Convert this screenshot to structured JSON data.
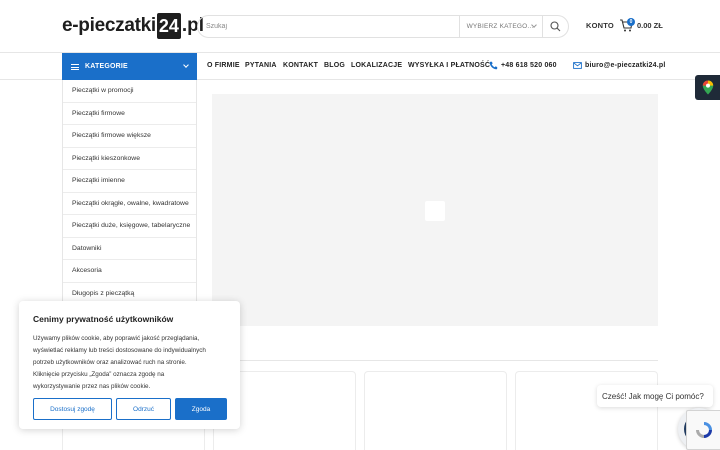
{
  "header": {
    "logo": {
      "prefix": "e-pieczatki",
      "number": "24",
      "suffix": ".pl"
    },
    "search": {
      "placeholder": "Szukaj",
      "category_select": "WYBIERZ KATEGO..."
    },
    "account_label": "KONTO",
    "cart": {
      "count": "0",
      "total": "0.00 ZŁ"
    }
  },
  "nav": {
    "categories_label": "KATEGORIE",
    "menu": [
      "O FIRMIE",
      "PYTANIA",
      "KONTAKT",
      "BLOG",
      "LOKALIZACJE",
      "WYSYŁKA I PŁATNOŚĆ"
    ],
    "phone": "+48 618 520 060",
    "email": "biuro@e-pieczatki24.pl"
  },
  "sidebar": {
    "items": [
      "Pieczątki w promocji",
      "Pieczątki firmowe",
      "Pieczątki firmowe większe",
      "Pieczątki kieszonkowe",
      "Pieczątki imienne",
      "Pieczątki okrągłe, owalne, kwadratowe",
      "Pieczątki duże, księgowe, tabelaryczne",
      "Datowniki",
      "Akcesoria",
      "Długopis z pieczątką"
    ]
  },
  "cookie": {
    "title": "Cenimy prywatność użytkowników",
    "lines": [
      "Używamy plików cookie, aby poprawić jakość przeglądania,",
      "wyświetlać reklamy lub treści dostosowane do indywidualnych",
      "potrzeb użytkowników oraz analizować ruch na stronie.",
      "Kliknięcie przycisku „Zgoda” oznacza zgodę na",
      "wykorzystywanie przez nas plików cookie."
    ],
    "buttons": {
      "customize": "Dostosuj zgodę",
      "reject": "Odrzuć",
      "accept": "Zgoda"
    }
  },
  "chat": {
    "greeting": "Cześć! Jak mogę Ci pomóc?"
  },
  "colors": {
    "accent": "#1a6fc9",
    "text": "#222222",
    "hero_bg": "#f4f4f4"
  }
}
